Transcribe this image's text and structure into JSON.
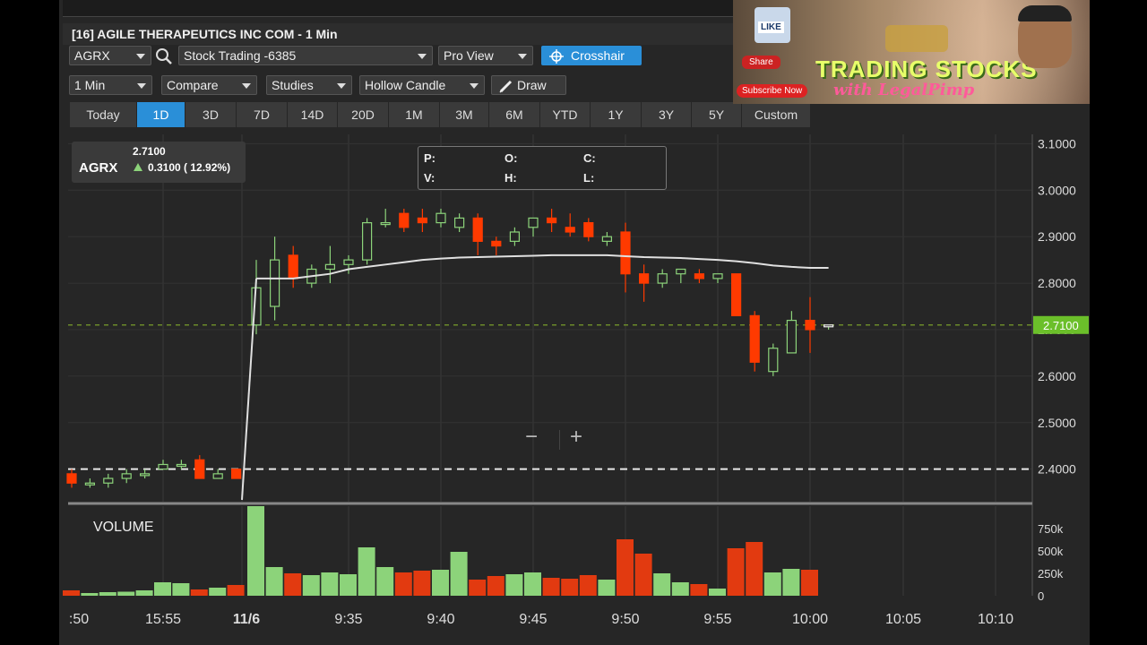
{
  "title": "[16] AGILE THERAPEUTICS INC COM - 1 Min",
  "toolbar": {
    "symbol": "AGRX",
    "account": "Stock Trading -6385",
    "view": "Pro View",
    "crosshair": "Crosshair",
    "interval": "1 Min",
    "compare": "Compare",
    "studies": "Studies",
    "candle_type": "Hollow Candle",
    "draw": "Draw"
  },
  "ranges": [
    "Today",
    "1D",
    "3D",
    "7D",
    "14D",
    "20D",
    "1M",
    "3M",
    "6M",
    "YTD",
    "1Y",
    "3Y",
    "5Y",
    "Custom"
  ],
  "active_range": "1D",
  "quote": {
    "symbol": "AGRX",
    "price": "2.7100",
    "change": "0.3100 ( 12.92%)"
  },
  "ohlc_labels": {
    "p": "P:",
    "o": "O:",
    "c": "C:",
    "v": "V:",
    "h": "H:",
    "l": "L:"
  },
  "zoom": {
    "minus": "−",
    "plus": "+"
  },
  "volume_label": "VOLUME",
  "price_axis": [
    "3.1000",
    "3.0000",
    "2.9000",
    "2.8000",
    "2.7000",
    "2.6000",
    "2.5000",
    "2.4000"
  ],
  "current_price_tag": "2.7100",
  "volume_axis": [
    "750k",
    "500k",
    "250k",
    "0"
  ],
  "time_axis": [
    ":50",
    "15:55",
    "11/6",
    "9:35",
    "9:40",
    "9:45",
    "9:50",
    "9:55",
    "10:00",
    "10:05",
    "10:10"
  ],
  "colors": {
    "up": "#8cd37a",
    "down": "#ff3a00",
    "accent": "#2a8fd8",
    "tag": "#6bbf2a"
  },
  "ad": {
    "title": "TRADING STOCKS",
    "subtitle": "with LegalPimp",
    "like": "LIKE",
    "share": "Share",
    "subscribe": "Subscribe Now"
  },
  "chart_data": {
    "type": "candlestick",
    "candles": [
      {
        "o": 2.39,
        "h": 2.4,
        "l": 2.36,
        "c": 2.37
      },
      {
        "o": 2.37,
        "h": 2.38,
        "l": 2.36,
        "c": 2.37
      },
      {
        "o": 2.37,
        "h": 2.39,
        "l": 2.36,
        "c": 2.38
      },
      {
        "o": 2.38,
        "h": 2.4,
        "l": 2.37,
        "c": 2.39
      },
      {
        "o": 2.39,
        "h": 2.4,
        "l": 2.38,
        "c": 2.39
      },
      {
        "o": 2.4,
        "h": 2.42,
        "l": 2.4,
        "c": 2.41
      },
      {
        "o": 2.41,
        "h": 2.42,
        "l": 2.4,
        "c": 2.41
      },
      {
        "o": 2.42,
        "h": 2.43,
        "l": 2.38,
        "c": 2.38
      },
      {
        "o": 2.38,
        "h": 2.4,
        "l": 2.38,
        "c": 2.39
      },
      {
        "o": 2.4,
        "h": 2.4,
        "l": 2.38,
        "c": 2.38
      },
      {
        "o": 2.71,
        "h": 2.85,
        "l": 2.69,
        "c": 2.79
      },
      {
        "o": 2.75,
        "h": 2.9,
        "l": 2.72,
        "c": 2.85
      },
      {
        "o": 2.86,
        "h": 2.88,
        "l": 2.79,
        "c": 2.81
      },
      {
        "o": 2.8,
        "h": 2.84,
        "l": 2.79,
        "c": 2.83
      },
      {
        "o": 2.83,
        "h": 2.88,
        "l": 2.8,
        "c": 2.84
      },
      {
        "o": 2.84,
        "h": 2.86,
        "l": 2.82,
        "c": 2.85
      },
      {
        "o": 2.85,
        "h": 2.94,
        "l": 2.84,
        "c": 2.93
      },
      {
        "o": 2.93,
        "h": 2.96,
        "l": 2.92,
        "c": 2.93
      },
      {
        "o": 2.95,
        "h": 2.96,
        "l": 2.91,
        "c": 2.92
      },
      {
        "o": 2.94,
        "h": 2.96,
        "l": 2.91,
        "c": 2.93
      },
      {
        "o": 2.93,
        "h": 2.96,
        "l": 2.92,
        "c": 2.95
      },
      {
        "o": 2.92,
        "h": 2.95,
        "l": 2.91,
        "c": 2.94
      },
      {
        "o": 2.94,
        "h": 2.95,
        "l": 2.86,
        "c": 2.89
      },
      {
        "o": 2.89,
        "h": 2.9,
        "l": 2.86,
        "c": 2.88
      },
      {
        "o": 2.89,
        "h": 2.92,
        "l": 2.88,
        "c": 2.91
      },
      {
        "o": 2.92,
        "h": 2.94,
        "l": 2.9,
        "c": 2.94
      },
      {
        "o": 2.94,
        "h": 2.96,
        "l": 2.91,
        "c": 2.93
      },
      {
        "o": 2.92,
        "h": 2.95,
        "l": 2.9,
        "c": 2.91
      },
      {
        "o": 2.93,
        "h": 2.94,
        "l": 2.89,
        "c": 2.9
      },
      {
        "o": 2.89,
        "h": 2.91,
        "l": 2.88,
        "c": 2.9
      },
      {
        "o": 2.91,
        "h": 2.93,
        "l": 2.78,
        "c": 2.82
      },
      {
        "o": 2.82,
        "h": 2.84,
        "l": 2.76,
        "c": 2.8
      },
      {
        "o": 2.8,
        "h": 2.83,
        "l": 2.79,
        "c": 2.82
      },
      {
        "o": 2.82,
        "h": 2.83,
        "l": 2.8,
        "c": 2.83
      },
      {
        "o": 2.82,
        "h": 2.83,
        "l": 2.8,
        "c": 2.81
      },
      {
        "o": 2.81,
        "h": 2.82,
        "l": 2.8,
        "c": 2.82
      },
      {
        "o": 2.82,
        "h": 2.82,
        "l": 2.73,
        "c": 2.73
      },
      {
        "o": 2.73,
        "h": 2.74,
        "l": 2.61,
        "c": 2.63
      },
      {
        "o": 2.61,
        "h": 2.67,
        "l": 2.6,
        "c": 2.66
      },
      {
        "o": 2.65,
        "h": 2.74,
        "l": 2.65,
        "c": 2.72
      },
      {
        "o": 2.72,
        "h": 2.77,
        "l": 2.65,
        "c": 2.7
      },
      {
        "o": 2.71,
        "h": 2.71,
        "l": 2.7,
        "c": 2.71
      }
    ],
    "volume": [
      60,
      30,
      40,
      45,
      60,
      150,
      140,
      70,
      90,
      120,
      1000,
      320,
      250,
      230,
      260,
      240,
      540,
      320,
      260,
      280,
      290,
      490,
      180,
      220,
      240,
      260,
      200,
      190,
      230,
      180,
      630,
      470,
      250,
      150,
      130,
      80,
      530,
      600,
      260,
      300,
      290,
      0
    ],
    "vwap": [
      null,
      null,
      null,
      null,
      null,
      null,
      null,
      null,
      null,
      null,
      2.81,
      2.81,
      2.81,
      2.815,
      2.82,
      2.83,
      2.835,
      2.84,
      2.845,
      2.85,
      2.853,
      2.855,
      2.856,
      2.857,
      2.858,
      2.859,
      2.86,
      2.86,
      2.86,
      2.86,
      2.858,
      2.856,
      2.855,
      2.854,
      2.852,
      2.85,
      2.847,
      2.843,
      2.838,
      2.835,
      2.833,
      2.833
    ],
    "yrange": [
      2.33,
      3.12
    ],
    "volume_range": [
      0,
      1000
    ],
    "current_price": 2.71,
    "prior_close": 2.4,
    "volume_unit": "k"
  }
}
